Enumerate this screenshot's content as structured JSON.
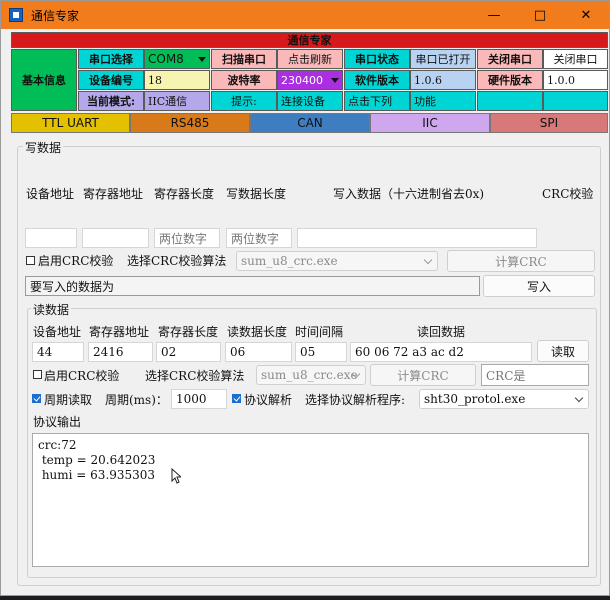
{
  "window": {
    "title": "通信专家",
    "min": "—",
    "max": "□",
    "close": "✕"
  },
  "banner": "通信专家",
  "info": {
    "label": "基本信息",
    "port_select_label": "串口选择",
    "port_value": "COM8",
    "scan_label": "扫描串口",
    "refresh_label": "点击刷新",
    "port_status_label": "串口状态",
    "port_status_value": "串口已打开",
    "close_port_label": "关闭串口",
    "close_port_action": "关闭串口",
    "device_no_label": "设备编号",
    "device_no_value": "18",
    "baud_label": "波特率",
    "baud_value": "230400",
    "sw_version_label": "软件版本",
    "sw_version_value": "1.0.6",
    "hw_version_label": "硬件版本",
    "hw_version_value": "1.0.0",
    "mode_label": "当前模式:",
    "mode_value": "IIC通信",
    "hint_label": "提示:",
    "hint_value": "连接设备",
    "hint_action": "点击下列",
    "hint_func": "功能"
  },
  "tabs": [
    "TTL UART",
    "RS485",
    "CAN",
    "IIC",
    "SPI"
  ],
  "tab_colors": [
    "#e3c000",
    "#d97a1a",
    "#3e7dc0",
    "#cfa7ef",
    "#d87878"
  ],
  "write": {
    "title": "写数据",
    "col_dev_addr": "设备地址",
    "col_reg_addr": "寄存器地址",
    "col_reg_len": "寄存器长度",
    "col_data_len": "写数据长度",
    "col_data": "写入数据（十六进制省去0x)",
    "col_crc": "CRC校验",
    "reg_len_placeholder": "两位数字",
    "data_len_placeholder": "两位数字",
    "enable_crc": "启用CRC校验",
    "select_crc_algo": "选择CRC校验算法",
    "crc_algo_value": "sum_u8_crc.exe",
    "calc_crc": "计算CRC",
    "status_text": "要写入的数据为",
    "write_button": "写入"
  },
  "read": {
    "title": "读数据",
    "col_dev_addr": "设备地址",
    "col_reg_addr": "寄存器地址",
    "col_reg_len": "寄存器长度",
    "col_data_len": "读数据长度",
    "col_interval": "时间间隔",
    "col_result": "读回数据",
    "dev_addr": "44",
    "reg_addr": "2416",
    "reg_len": "02",
    "data_len": "06",
    "interval": "05",
    "result": "60 06 72 a3 ac d2",
    "read_button": "读取",
    "enable_crc": "启用CRC校验",
    "select_crc_algo": "选择CRC校验算法",
    "crc_algo_value": "sum_u8_crc.exe",
    "calc_crc": "计算CRC",
    "crc_result_placeholder": "CRC是",
    "periodic_read": "周期读取",
    "period_label": "周期(ms)：",
    "period_value": "1000",
    "protocol_parse": "协议解析",
    "select_parser": "选择协议解析程序:",
    "parser_value": "sht30_protol.exe",
    "output_title": "协议输出",
    "output_lines": [
      "crc:72",
      " temp = 20.642023",
      " humi = 63.935303"
    ]
  }
}
